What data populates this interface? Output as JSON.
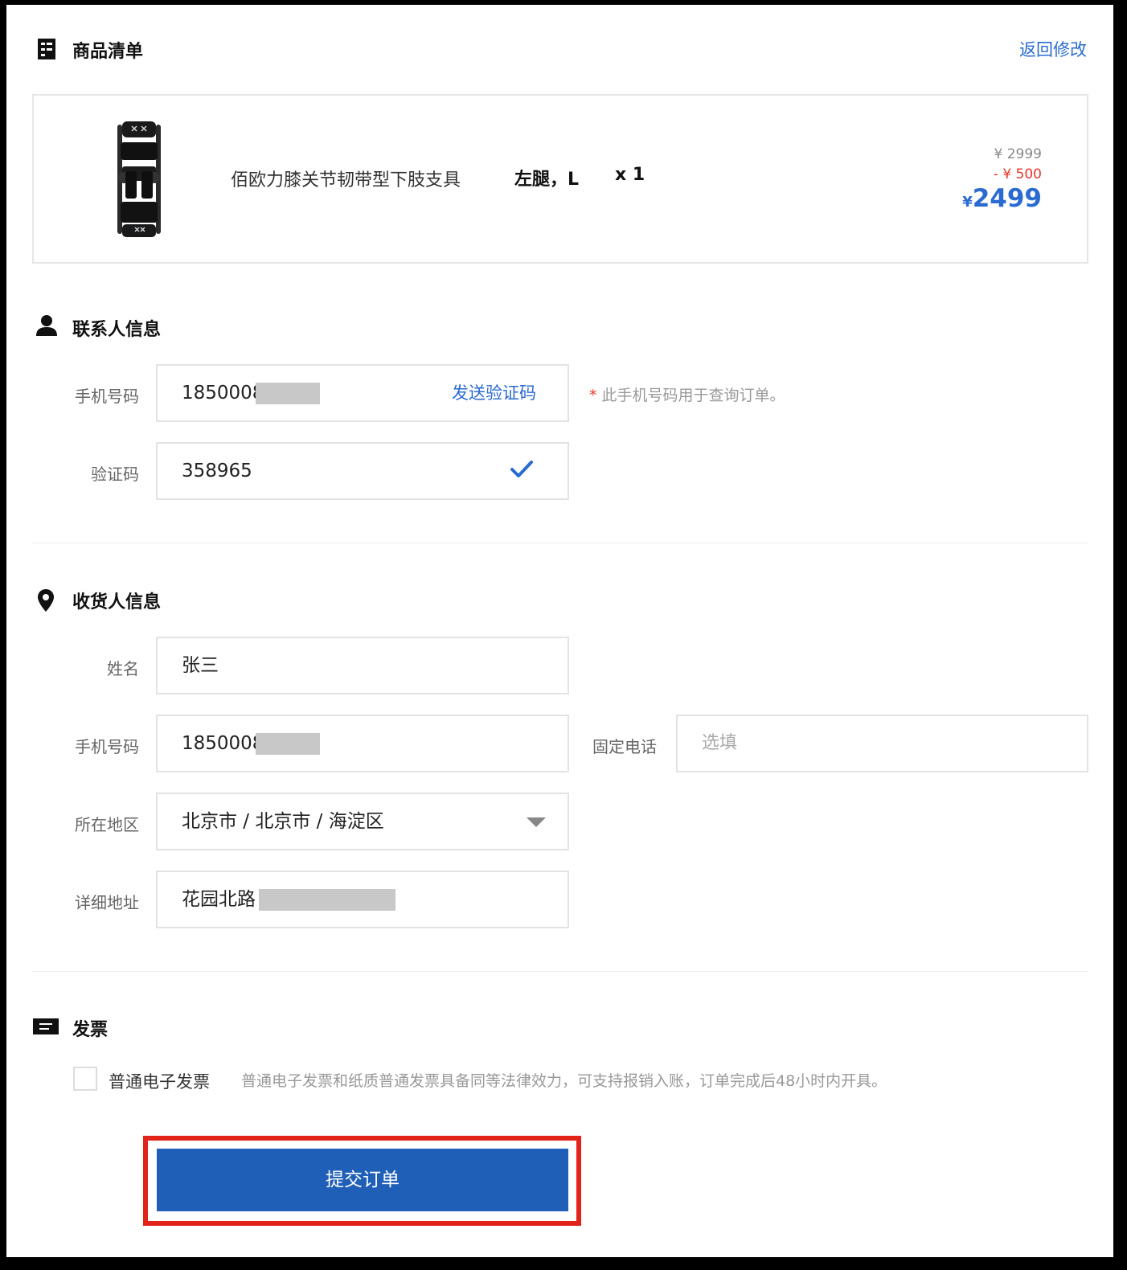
{
  "product_section": {
    "title": "商品清单",
    "back_link": "返回修改",
    "item": {
      "name": "佰欧力膝关节韧带型下肢支具",
      "spec": "左腿，L",
      "quantity": "x 1",
      "original_price": "¥ 2999",
      "discount": "- ¥ 500",
      "currency": "¥",
      "final_price": "2499"
    }
  },
  "contact_section": {
    "title": "联系人信息",
    "phone_label": "手机号码",
    "phone_value": "1850008",
    "send_code": "发送验证码",
    "phone_note_star": "*",
    "phone_note": "此手机号码用于查询订单。",
    "code_label": "验证码",
    "code_value": "358965"
  },
  "recipient_section": {
    "title": "收货人信息",
    "name_label": "姓名",
    "name_value": "张三",
    "phone_label": "手机号码",
    "phone_value": "1850008",
    "landline_label": "固定电话",
    "landline_placeholder": "选填",
    "region_label": "所在地区",
    "region_value": "北京市 / 北京市 / 海淀区",
    "address_label": "详细地址",
    "address_value": "花园北路"
  },
  "invoice_section": {
    "title": "发票",
    "option_label": "普通电子发票",
    "option_desc": "普通电子发票和纸质普通发票具备同等法律效力，可支持报销入账，订单完成后48小时内开具。"
  },
  "submit_label": "提交订单",
  "colors": {
    "accent": "#2a6bd1",
    "button": "#1f5fb8",
    "discount": "#e8362a",
    "highlight": "#e2231a"
  }
}
